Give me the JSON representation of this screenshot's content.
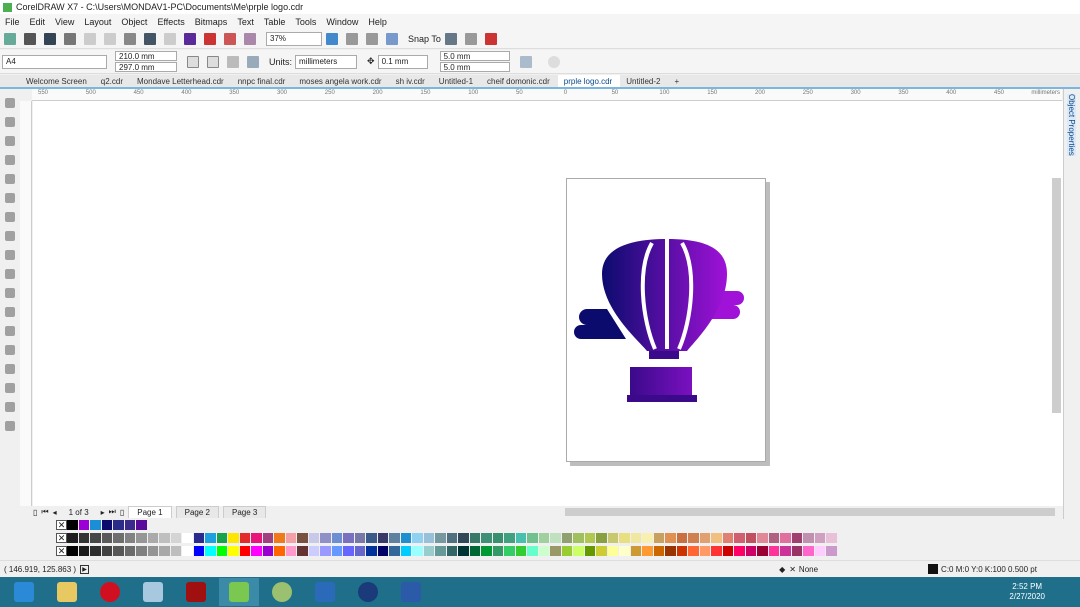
{
  "window": {
    "title": "CorelDRAW X7 - C:\\Users\\MONDAV1-PC\\Documents\\Me\\prple logo.cdr"
  },
  "menu": [
    "File",
    "Edit",
    "View",
    "Layout",
    "Object",
    "Effects",
    "Bitmaps",
    "Text",
    "Table",
    "Tools",
    "Window",
    "Help"
  ],
  "toolbar": {
    "zoom": "37%",
    "snap_to": "Snap To"
  },
  "propertybar": {
    "page_size": "A4",
    "width": "210.0 mm",
    "height": "297.0 mm",
    "units_label": "Units:",
    "units": "millimeters",
    "nudge": "0.1 mm",
    "dup_x": "5.0 mm",
    "dup_y": "5.0 mm"
  },
  "tabs": [
    "Welcome Screen",
    "q2.cdr",
    "Mondave Letterhead.cdr",
    "nnpc final.cdr",
    "moses angela work.cdr",
    "sh iv.cdr",
    "Untitled-1",
    "cheif domonic.cdr",
    "prple logo.cdr",
    "Untitled-2"
  ],
  "active_tab": "prple logo.cdr",
  "ruler": {
    "labels": [
      "550",
      "500",
      "450",
      "400",
      "350",
      "300",
      "250",
      "200",
      "150",
      "100",
      "50",
      "0",
      "50",
      "100",
      "150",
      "200",
      "250",
      "300",
      "350",
      "400",
      "450"
    ],
    "unit": "millimeters"
  },
  "docker": {
    "label": "Object Properties"
  },
  "pages": {
    "counter": "1 of 3",
    "tabs": [
      "Page 1",
      "Page 2",
      "Page 3"
    ]
  },
  "palettes": {
    "doc": [
      "#000000",
      "#9b00d6",
      "#1a8fd6",
      "#0b0b6e",
      "#2b2b8a",
      "#3a2a8a",
      "#5a0a9a"
    ],
    "row1": [
      "#1e1e1e",
      "#333",
      "#474747",
      "#5a5a5a",
      "#6e6e6e",
      "#828282",
      "#969696",
      "#aaa",
      "#bfbfbf",
      "#d4d4d4",
      "#fff",
      "#2b2b8f",
      "#1ca0e0",
      "#16a34a",
      "#ffe600",
      "#e32b2b",
      "#e8157a",
      "#a04080",
      "#f07a1a",
      "#f4a0a8",
      "#7a5040",
      "#c8c8e8",
      "#9090c8",
      "#6b8fd0",
      "#7a70c0",
      "#7878a8",
      "#3a5a8a",
      "#3a3a68",
      "#6080a0",
      "#1e90d0",
      "#90d0f0",
      "#98c0d8",
      "#7898a0",
      "#507080",
      "#304858",
      "#387868",
      "#409078",
      "#389070",
      "#40a080",
      "#48c0b0",
      "#70c090",
      "#a0d0a0",
      "#c0e0c0",
      "#90a070",
      "#a0c060",
      "#b0c850",
      "#88a040",
      "#c8c870",
      "#e8e080",
      "#f0e8a0",
      "#f8f0b0",
      "#c8a060",
      "#e09050",
      "#c87040",
      "#d08050",
      "#e0a070",
      "#f0c080",
      "#e08070",
      "#d06070",
      "#c05060",
      "#e08898",
      "#b06080",
      "#e070a0",
      "#a04070",
      "#c090b0",
      "#d0a0c0",
      "#e8c0d8"
    ],
    "row2": [
      "#000",
      "#1a1a1a",
      "#2e2e2e",
      "#424242",
      "#575757",
      "#6b6b6b",
      "#808080",
      "#949494",
      "#a8a8a8",
      "#bdbdbd",
      "#fff",
      "#0000ff",
      "#00ffff",
      "#00ff00",
      "#ffff00",
      "#ff0000",
      "#ff00ff",
      "#9900cc",
      "#ff6600",
      "#ff99cc",
      "#663333",
      "#ccccff",
      "#9999ff",
      "#6699ff",
      "#6666ff",
      "#6666cc",
      "#003399",
      "#000066",
      "#336699",
      "#00ccff",
      "#99ffff",
      "#99cccc",
      "#669999",
      "#336666",
      "#003333",
      "#006633",
      "#009933",
      "#339966",
      "#33cc66",
      "#33cc33",
      "#66ffcc",
      "#ccffcc",
      "#999966",
      "#99cc33",
      "#ccff66",
      "#669900",
      "#cccc33",
      "#ffff99",
      "#ffffcc",
      "#cc9933",
      "#ff9933",
      "#cc6600",
      "#993300",
      "#cc3300",
      "#ff6633",
      "#ff9966",
      "#ff3333",
      "#cc0000",
      "#ff0066",
      "#cc0066",
      "#990033",
      "#ff3399",
      "#cc3399",
      "#993366",
      "#ff66cc",
      "#ffccff",
      "#cc99cc"
    ]
  },
  "status": {
    "coords": "( 146.919, 125.863 )",
    "fill": "None",
    "outline": "C:0 M:0 Y:0 K:100  0.500 pt"
  },
  "taskbar": {
    "time": "2:52 PM",
    "date": "2/27/2020",
    "apps": [
      "internet-explorer",
      "file-explorer",
      "opera",
      "calculator",
      "acrobat-reader",
      "coreldraw",
      "corel-capture",
      "photoshop",
      "bluetooth",
      "word"
    ]
  },
  "colors": {
    "logo_dark": "#0b0b6e",
    "logo_light": "#a012d8",
    "accent": "#7ab6e0",
    "taskbar": "#1f6f8b"
  }
}
